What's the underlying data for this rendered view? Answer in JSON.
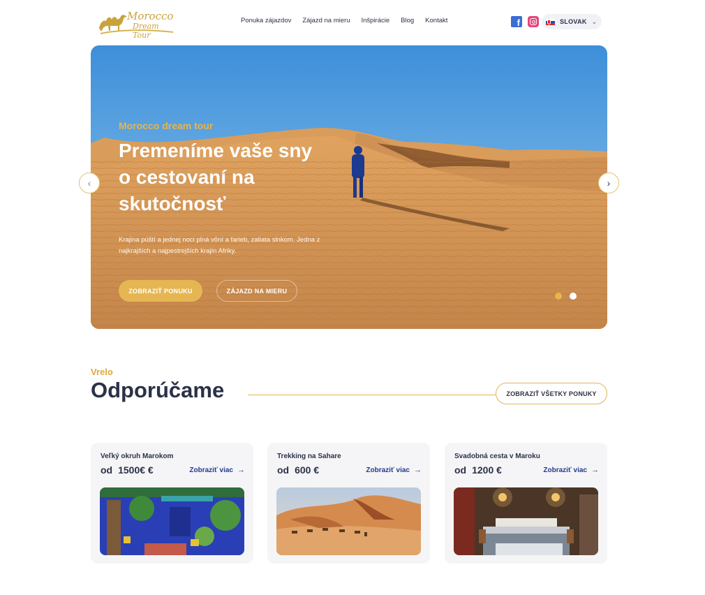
{
  "header": {
    "logo": {
      "line1": "Morocco",
      "line2": "Dream Tour"
    },
    "nav": [
      "Ponuka zájazdov",
      "Zájazd na mieru",
      "Inšpirácie",
      "Blog",
      "Kontakt"
    ],
    "language": {
      "label": "SLOVAK",
      "flag_icon": "slovakia-flag-icon"
    }
  },
  "hero": {
    "kicker": "Morocco dream tour",
    "title": "Premeníme vaše sny o cestovaní na skutočnosť",
    "description": "Krajina púští a jednej noci plná vôní a farieb, zaliata slnkom. Jedna z najkrajších a najpestrejších krajín Afriky.",
    "primary_button": "ZOBRAZIŤ PONUKU",
    "secondary_button": "ZÁJAZD NA MIERU",
    "slides_total": 2,
    "active_slide": 1
  },
  "recommend": {
    "kicker": "Vrelo",
    "title": "Odporúčame",
    "all_button": "ZOBRAZIŤ VŠETKY PONUKY"
  },
  "cards": [
    {
      "title": "Veľký okruh Marokom",
      "price_prefix": "od",
      "price": "1500€ €",
      "more": "Zobraziť viac"
    },
    {
      "title": "Trekking na Sahare",
      "price_prefix": "od",
      "price": "600 €",
      "more": "Zobraziť viac"
    },
    {
      "title": "Svadobná cesta v Maroku",
      "price_prefix": "od",
      "price": "1200 €",
      "more": "Zobraziť viac"
    }
  ],
  "colors": {
    "accent": "#e6b653",
    "navy": "#2b3146",
    "link": "#233a8c"
  }
}
